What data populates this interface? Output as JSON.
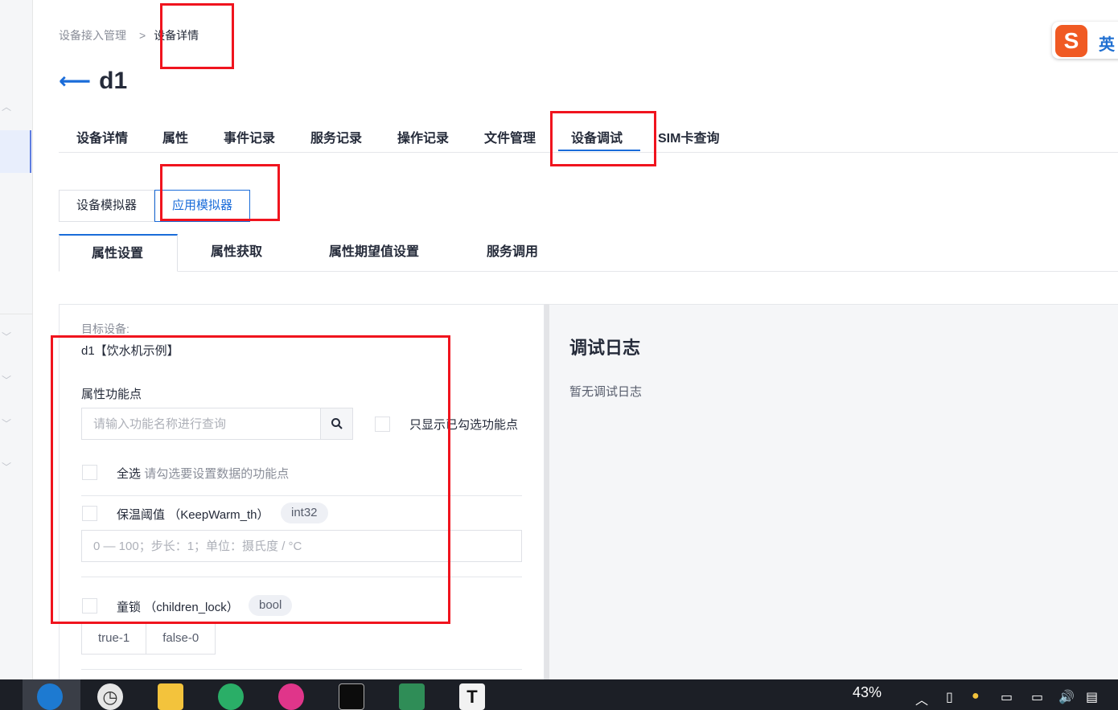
{
  "breadcrumb": {
    "parent": "设备接入管理",
    "separator": ">",
    "current": "设备详情"
  },
  "device": {
    "name": "d1"
  },
  "tabs": [
    {
      "label": "设备详情"
    },
    {
      "label": "属性"
    },
    {
      "label": "事件记录"
    },
    {
      "label": "服务记录"
    },
    {
      "label": "操作记录"
    },
    {
      "label": "文件管理"
    },
    {
      "label": "设备调试",
      "active": true
    },
    {
      "label": "SIM卡查询"
    }
  ],
  "simulator": {
    "device_sim": "设备模拟器",
    "app_sim": "应用模拟器",
    "active": "应用模拟器"
  },
  "subtabs": [
    {
      "label": "属性设置",
      "active": true
    },
    {
      "label": "属性获取"
    },
    {
      "label": "属性期望值设置"
    },
    {
      "label": "服务调用"
    }
  ],
  "form": {
    "target_label": "目标设备:",
    "target_value": "d1【饮水机示例】",
    "feature_label": "属性功能点",
    "search_placeholder": "请输入功能名称进行查询",
    "only_checked_label": "只显示已勾选功能点",
    "select_all_label": "全选",
    "select_all_hint": "请勾选要设置数据的功能点",
    "properties": [
      {
        "name": "保温阈值",
        "identifier": "（KeepWarm_th）",
        "type": "int32",
        "placeholder": "0 — 100；步长：1；单位：摄氏度 / °C"
      },
      {
        "name": "童锁",
        "identifier": "（children_lock）",
        "type": "bool",
        "options": [
          "true-1",
          "false-0"
        ]
      }
    ]
  },
  "log": {
    "title": "调试日志",
    "empty": "暂无调试日志"
  },
  "ime": {
    "logo": "S",
    "lang": "英"
  },
  "taskbar": {
    "battery": "43%"
  },
  "colors": {
    "accent": "#1a6cd9",
    "annotation": "#f0141e",
    "ime": "#f05a23"
  }
}
